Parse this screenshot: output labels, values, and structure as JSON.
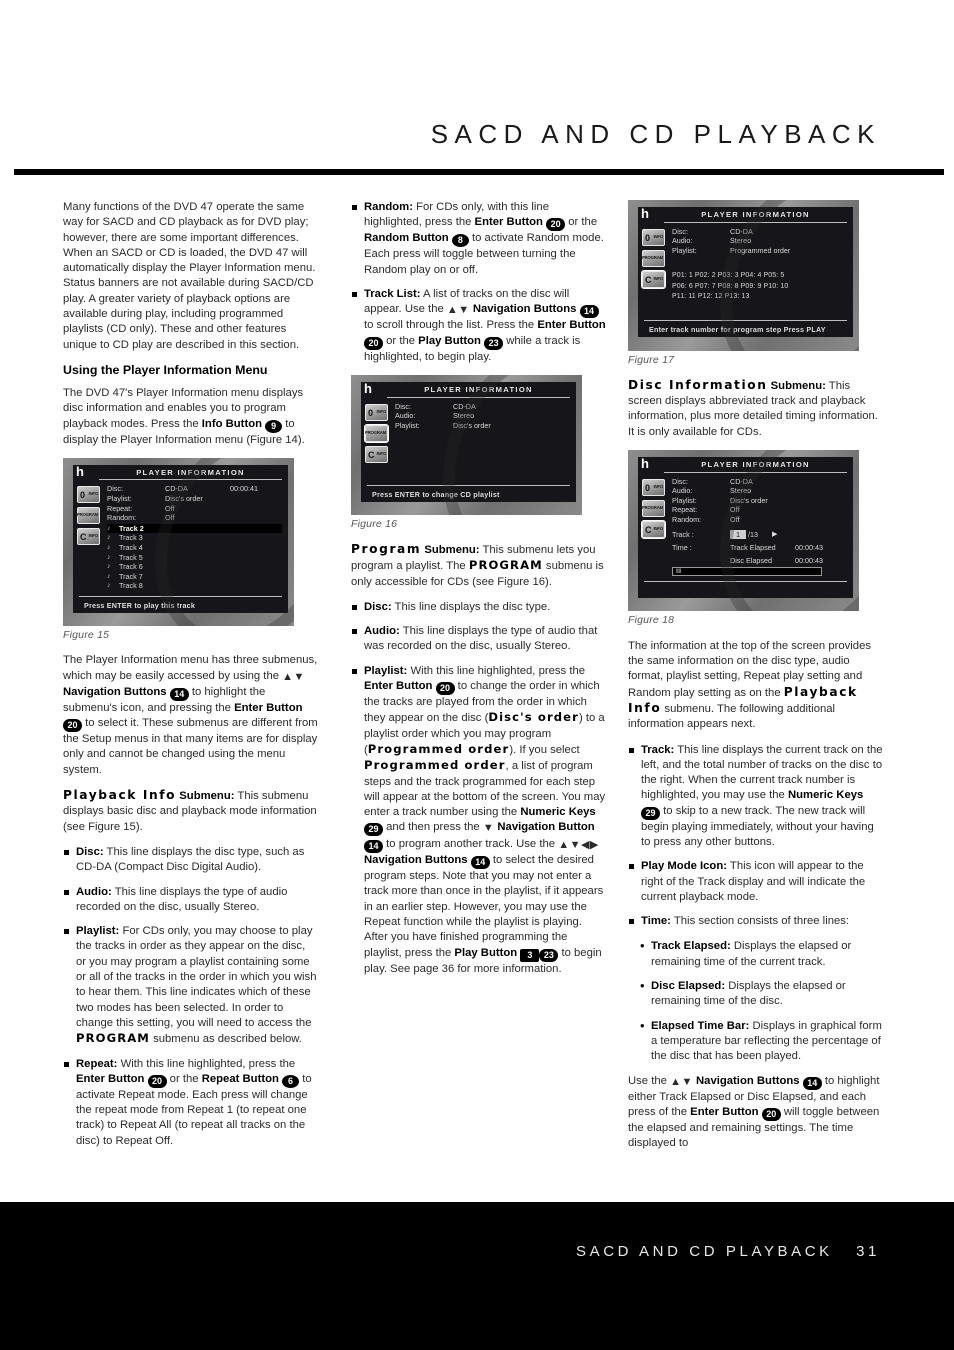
{
  "header": {
    "title": "SACD AND CD PLAYBACK"
  },
  "footer": {
    "title": "SACD AND CD PLAYBACK",
    "page_number": "31"
  },
  "column1": {
    "intro": "Many functions of the DVD 47 operate the same way for SACD and CD playback as for DVD play; however, there are some important differences. When an SACD or CD is loaded, the DVD 47 will automatically display the Player Information menu. Status banners are not available during SACD/CD play. A greater variety of playback options are available during play, including programmed playlists (CD only). These and other features unique to CD play are described in this section.",
    "subhead": "Using the Player Information Menu",
    "para2_a": "The DVD 47's Player Information menu displays disc information and enables you to program playback modes. Press the ",
    "para2_info_button": "Info Button",
    "para2_info_key": "9",
    "para2_b": " to display the Player Information menu (Figure 14).",
    "fig15_caption": "Figure 15",
    "para3_a": "The Player Information menu has three submenus, which may be easily accessed by using the ",
    "para3_nav": "Navigation Buttons",
    "para3_nav_key": "14",
    "para3_b": " to highlight the submenu's icon, and pressing the ",
    "para3_enter": "Enter Button",
    "para3_enter_key": "20",
    "para3_c": " to select it. These submenus are different from the Setup menus in that many items are for display only and cannot be changed using the menu system.",
    "playback_info_lcd": "Playback Info",
    "playback_info_label": "Submenu:",
    "playback_info_text": " This submenu displays basic disc and playback mode information (see Figure 15).",
    "bullets": [
      {
        "term": "Disc:",
        "text": " This line displays the disc type, such as CD-DA (Compact Disc Digital Audio)."
      },
      {
        "term": "Audio:",
        "text": " This line displays the type of audio recorded on the disc, usually Stereo."
      },
      {
        "term": "Playlist:",
        "text_a": " For CDs only, you may choose to play the tracks in order as they appear on the disc, or you may program a playlist containing some or all of the tracks in the order in which you wish to hear them. This line indicates which of these two modes has been selected. In order to change this setting, you will need to access the ",
        "lcd": "PROGRAM",
        "text_b": " submenu as described below."
      },
      {
        "term": "Repeat:",
        "text_a": " With this line highlighted, press the ",
        "enter": "Enter Button",
        "enter_key": "20",
        "text_b": " or the ",
        "repeat": "Repeat Button",
        "repeat_key": "6",
        "text_c": " to activate Repeat mode. Each press will change the repeat mode from Repeat 1 (to repeat one track) to Repeat All (to repeat all tracks on the disc) to Repeat Off."
      }
    ]
  },
  "column2": {
    "bullets_top": [
      {
        "term": "Random:",
        "text_a": " For CDs only, with this line highlighted, press the ",
        "enter": "Enter Button",
        "enter_key": "20",
        "text_b": " or the ",
        "random": "Random Button",
        "random_key": "8",
        "text_c": " to activate Random mode. Each press will toggle between turning the Random play on or off."
      },
      {
        "term": "Track List:",
        "text_a": " A list of tracks on the disc will appear. Use the ",
        "nav": "Navigation Buttons",
        "nav_key": "14",
        "text_b": " to scroll through the list. Press the ",
        "enter": "Enter Button",
        "enter_key": "20",
        "text_c": " or the ",
        "play": "Play Button",
        "play_key": "23",
        "text_d": " while a track is highlighted, to begin play."
      }
    ],
    "fig16_caption": "Figure 16",
    "program_lcd": "Program",
    "program_label": "Submenu:",
    "program_text_a": " This submenu lets you program a playlist. The ",
    "program_lcd2": "PROGRAM",
    "program_text_b": " submenu is only accessible for CDs (see Figure 16).",
    "bullets": [
      {
        "term": "Disc:",
        "text": " This line displays the disc type."
      },
      {
        "term": "Audio:",
        "text": " This line displays the type of audio that was recorded on the disc, usually Stereo."
      },
      {
        "term": "Playlist:",
        "text_a": " With this line highlighted, press the ",
        "enter": "Enter Button",
        "enter_key": "20",
        "text_b": " to change the order in which the tracks are played from the order in which they appear on the disc (",
        "lcd_discs": "Disc's order",
        "text_c": ") to a playlist order which you may program (",
        "lcd_prog": "Programmed order",
        "text_d": "). If you select ",
        "lcd_prog2": "Programmed order",
        "text_e": ", a list of program steps and the track programmed for each step will appear at the bottom of the screen. You may enter a track number using the ",
        "numeric": "Numeric Keys",
        "numeric_key": "29",
        "text_f": " and then press the ",
        "nav_down": "Navigation Button",
        "nav_down_key": "14",
        "text_g": " to program another track. Use the ",
        "nav_all": "Navigation Buttons",
        "nav_all_key": "14",
        "text_h": " to select the desired program steps. Note that you may not enter a track more than once in the playlist, if it appears in an earlier step. However, you may use the Repeat function while the playlist is playing. After you have finished programming the playlist, press the ",
        "play": "Play Button",
        "play_key_sq": "3",
        "play_key": "23",
        "text_i": " to begin play. See page 36 for more information."
      }
    ]
  },
  "column3": {
    "fig17_caption": "Figure 17",
    "disc_info_lcd": "Disc Information",
    "disc_info_label": "Submenu:",
    "disc_info_text": " This screen displays abbreviated track and playback information, plus more detailed timing information. It is only available for CDs.",
    "fig18_caption": "Figure 18",
    "para_a": "The information at the top of the screen provides the same information on the disc type, audio format, playlist setting, Repeat play setting and Random play setting as on the ",
    "para_lcd": "Playback Info",
    "para_b": " submenu. The following additional information appears next.",
    "bullets": [
      {
        "term": "Track:",
        "text_a": " This line displays the current track on the left, and the total number of tracks on the disc to the right. When the current track number is highlighted, you may use the ",
        "numeric": "Numeric Keys",
        "numeric_key": "29",
        "text_b": " to skip to a new track. The new track will begin playing immediately, without your having to press any other buttons."
      },
      {
        "term": "Play Mode Icon:",
        "text": " This icon will appear to the right of the Track display and will indicate the current playback mode."
      },
      {
        "term": "Time:",
        "text": " This section consists of three lines:"
      }
    ],
    "sub_bullets": [
      {
        "term": "Track Elapsed:",
        "text": " Displays the elapsed or remaining time of the current track."
      },
      {
        "term": "Disc Elapsed:",
        "text": " Displays the elapsed or remaining time of the disc."
      },
      {
        "term": "Elapsed Time Bar:",
        "text": " Displays in graphical form a temperature bar reflecting the percentage of the disc that has been played."
      }
    ],
    "closing_a": "Use the ",
    "closing_nav": "Navigation Buttons",
    "closing_nav_key": "14",
    "closing_b": " to highlight either Track Elapsed or Disc Elapsed, and each press of the ",
    "closing_enter": "Enter Button",
    "closing_enter_key": "20",
    "closing_c": " will toggle between the elapsed and remaining settings. The time displayed to"
  },
  "figures": {
    "fig15": {
      "brand": "h",
      "ghost": "47",
      "header": "PLAYER INFORMATION",
      "icons": [
        {
          "glyph": "0",
          "sub": "INFO"
        },
        {
          "glyph": "",
          "sub": "PROGRAM"
        },
        {
          "glyph": "C",
          "sub": "INFO"
        }
      ],
      "rows": [
        {
          "label": "Disc:",
          "value": "CD-DA",
          "extra": "00:00:41"
        },
        {
          "label": "Playlist:",
          "value": "Disc's order",
          "extra": ""
        },
        {
          "label": "Repeat:",
          "value": "Off",
          "extra": ""
        },
        {
          "label": "Random:",
          "value": "Off",
          "extra": ""
        }
      ],
      "tracks": [
        "Track 2",
        "Track 3",
        "Track 4",
        "Track 5",
        "Track 6",
        "Track 7",
        "Track 8"
      ],
      "highlighted_track": "Track 2",
      "footer": "Press ENTER to play this track"
    },
    "fig16": {
      "brand": "h",
      "ghost": "47",
      "header": "PLAYER INFORMATION",
      "icons": [
        {
          "glyph": "0",
          "sub": "INFO"
        },
        {
          "glyph": "",
          "sub": "PROGRAM"
        },
        {
          "glyph": "C",
          "sub": "INFO"
        }
      ],
      "rows": [
        {
          "label": "Disc:",
          "value": "CD-DA"
        },
        {
          "label": "Audio:",
          "value": "Stereo"
        },
        {
          "label": "Playlist:",
          "value": "Disc's order"
        }
      ],
      "footer": "Press ENTER to change CD playlist"
    },
    "fig17": {
      "brand": "h",
      "ghost": "47",
      "header": "PLAYER INFORMATION",
      "icons": [
        {
          "glyph": "0",
          "sub": "INFO"
        },
        {
          "glyph": "",
          "sub": "PROGRAM"
        },
        {
          "glyph": "C",
          "sub": "INFO"
        }
      ],
      "rows": [
        {
          "label": "Disc:",
          "value": "CD-DA"
        },
        {
          "label": "Audio:",
          "value": "Stereo"
        },
        {
          "label": "Playlist:",
          "value": "Programmed order"
        }
      ],
      "program_steps_line1": "P01:  1   P02:  2   P03:  3   P04:  4   P05:  5",
      "program_steps_line2": "P06:  6   P07:  7   P08:  8   P09:  9   P10: 10",
      "program_steps_line3": "P11: 11   P12: 12   P13: 13",
      "highlighted_step": "1",
      "footer": "Enter track number for program step Press PLAY"
    },
    "fig18": {
      "brand": "h",
      "ghost": "47",
      "header": "PLAYER INFORMATION",
      "icons": [
        {
          "glyph": "0",
          "sub": "INFO"
        },
        {
          "glyph": "",
          "sub": "PROGRAM"
        },
        {
          "glyph": "C",
          "sub": "INFO"
        }
      ],
      "rows": [
        {
          "label": "Disc:",
          "value": "CD-DA"
        },
        {
          "label": "Audio:",
          "value": "Stereo"
        },
        {
          "label": "Playlist:",
          "value": "Disc's order"
        },
        {
          "label": "Repeat:",
          "value": "Off"
        },
        {
          "label": "Random:",
          "value": "Off"
        }
      ],
      "track_label": "Track :",
      "track_current": "1",
      "track_total": "/13",
      "time_label": "Time :",
      "track_elapsed_label": "Track Elapsed",
      "track_elapsed_value": "00:00:43",
      "disc_elapsed_label": "Disc Elapsed",
      "disc_elapsed_value": "00:00:43",
      "bar_text": "IIII",
      "footer": ""
    }
  }
}
